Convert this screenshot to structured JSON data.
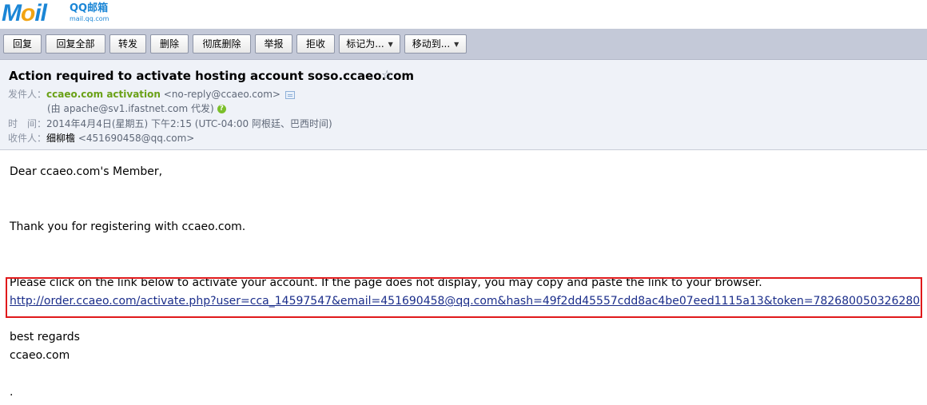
{
  "logo": {
    "brand": "MOil",
    "product": "QQ邮箱",
    "url": "mail.qq.com"
  },
  "toolbar": {
    "reply": "回复",
    "reply_all": "回复全部",
    "forward": "转发",
    "delete": "删除",
    "delete_permanently": "彻底删除",
    "report": "举报",
    "reject": "拒收",
    "mark_as": "标记为...",
    "move_to": "移动到..."
  },
  "header": {
    "subject": "Action required to activate hosting account soso.ccaeo.com",
    "from_label": "发件人：",
    "from_name": "ccaeo.com activation",
    "from_address": "<no-reply@ccaeo.com>",
    "via": "(由 apache@sv1.ifastnet.com 代发)",
    "time_label": "时　间：",
    "time_value": "2014年4月4日(星期五) 下午2:15 (UTC-04:00 阿根廷、巴西时间)",
    "to_label": "收件人：",
    "to_name": "细柳檐",
    "to_address": "<451690458@qq.com>"
  },
  "body": {
    "greeting": "Dear ccaeo.com's Member,",
    "thanks": "Thank you for registering with ccaeo.com.",
    "instruction": "Please click on the link below to activate your account. If the page does not display, you may copy and paste the link to your browser.",
    "activation_link": "http://order.ccaeo.com/activate.php?user=cca_14597547&email=451690458@qq.com&hash=49f2dd45557cdd8ac4be07eed1115a13&token=782680050326280",
    "regards": "best regards",
    "signature": "ccaeo.com",
    "trailing": "."
  },
  "colors": {
    "highlight_box": "#e0191b",
    "sender": "#6aa117",
    "link": "#1a2d8a"
  }
}
